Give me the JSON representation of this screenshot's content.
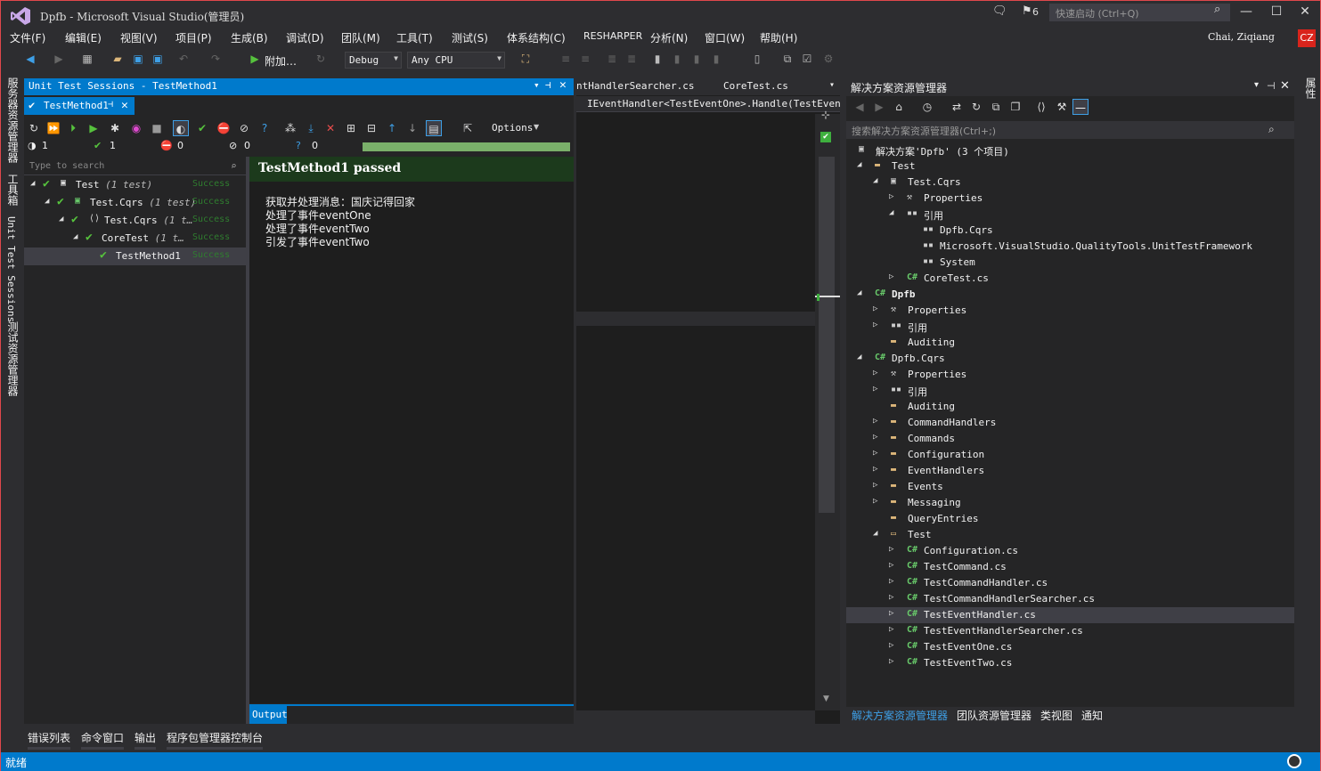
{
  "window": {
    "title": "Dpfb - Microsoft Visual Studio(管理员)",
    "notifications_count": "6",
    "quick_launch_placeholder": "快速启动 (Ctrl+Q)"
  },
  "menu": [
    "文件(F)",
    "编辑(E)",
    "视图(V)",
    "项目(P)",
    "生成(B)",
    "调试(D)",
    "团队(M)",
    "工具(T)",
    "测试(S)",
    "体系结构(C)",
    "RESHARPER",
    "分析(N)",
    "窗口(W)",
    "帮助(H)"
  ],
  "user": {
    "name": "Chai, Ziqiang",
    "initials": "CZ"
  },
  "toolbar": {
    "attach_label": "附加…",
    "config": "Debug",
    "platform": "Any CPU"
  },
  "left_tabs": [
    "服务器资源管理器",
    "工具箱",
    "Unit Test Sessions",
    "测试资源管理器"
  ],
  "right_tabs": [
    "属性"
  ],
  "unit_test": {
    "panel_title": "Unit Test Sessions - TestMethod1",
    "session_tab": "TestMethod1",
    "options_label": "Options",
    "counts": {
      "total": "1",
      "passed": "1",
      "failed": "0",
      "ignored": "0",
      "unknown": "0"
    },
    "progress": 1.0,
    "search_placeholder": "Type to search",
    "tree": [
      {
        "label": "Test",
        "count": "(1 test)",
        "status": "Success"
      },
      {
        "label": "Test.Cqrs",
        "count": "(1 test)",
        "status": "Success"
      },
      {
        "label": "Test.Cqrs",
        "count": "(1 t…",
        "status": "Success"
      },
      {
        "label": "CoreTest",
        "count": "(1 t…",
        "status": "Success"
      },
      {
        "label": "TestMethod1",
        "count": "",
        "status": "Success"
      }
    ],
    "detail_title": "TestMethod1 passed",
    "detail_output": "获取并处理消息：国庆记得回家\n处理了事件eventOne\n处理了事件eventTwo\n引发了事件eventTwo",
    "output_tab": "Output"
  },
  "editor": {
    "tabs": [
      "ntHandlerSearcher.cs",
      "CoreTest.cs"
    ],
    "nav": "IEventHandler<TestEventOne>.Handle(TestEvent("
  },
  "solution_explorer": {
    "title": "解决方案资源管理器",
    "search_placeholder": "搜索解决方案资源管理器(Ctrl+;)",
    "tree": [
      {
        "label": "解决方案'Dpfb' (3 个项目)",
        "icon": "solution-icon"
      },
      {
        "label": "Test",
        "icon": "folder-icon"
      },
      {
        "label": "Test.Cqrs",
        "icon": "project-icon"
      },
      {
        "label": "Properties",
        "icon": "wrench-icon"
      },
      {
        "label": "引用",
        "icon": "references-icon"
      },
      {
        "label": "Dpfb.Cqrs",
        "icon": "reference-icon"
      },
      {
        "label": "Microsoft.VisualStudio.QualityTools.UnitTestFramework",
        "icon": "reference-icon"
      },
      {
        "label": "System",
        "icon": "reference-icon"
      },
      {
        "label": "CoreTest.cs",
        "icon": "csharp-file-icon"
      },
      {
        "label": "Dpfb",
        "icon": "csharp-project-icon"
      },
      {
        "label": "Properties",
        "icon": "wrench-icon"
      },
      {
        "label": "引用",
        "icon": "references-icon"
      },
      {
        "label": "Auditing",
        "icon": "folder-icon"
      },
      {
        "label": "Dpfb.Cqrs",
        "icon": "csharp-project-icon"
      },
      {
        "label": "Properties",
        "icon": "wrench-icon"
      },
      {
        "label": "引用",
        "icon": "references-icon"
      },
      {
        "label": "Auditing",
        "icon": "folder-icon"
      },
      {
        "label": "CommandHandlers",
        "icon": "folder-icon"
      },
      {
        "label": "Commands",
        "icon": "folder-icon"
      },
      {
        "label": "Configuration",
        "icon": "folder-icon"
      },
      {
        "label": "EventHandlers",
        "icon": "folder-icon"
      },
      {
        "label": "Events",
        "icon": "folder-icon"
      },
      {
        "label": "Messaging",
        "icon": "folder-icon"
      },
      {
        "label": "QueryEntries",
        "icon": "folder-icon"
      },
      {
        "label": "Test",
        "icon": "folder-open-icon"
      },
      {
        "label": "Configuration.cs",
        "icon": "csharp-file-icon"
      },
      {
        "label": "TestCommand.cs",
        "icon": "csharp-file-icon"
      },
      {
        "label": "TestCommandHandler.cs",
        "icon": "csharp-file-icon"
      },
      {
        "label": "TestCommandHandlerSearcher.cs",
        "icon": "csharp-file-icon"
      },
      {
        "label": "TestEventHandler.cs",
        "icon": "csharp-file-icon"
      },
      {
        "label": "TestEventHandlerSearcher.cs",
        "icon": "csharp-file-icon"
      },
      {
        "label": "TestEventOne.cs",
        "icon": "csharp-file-icon"
      },
      {
        "label": "TestEventTwo.cs",
        "icon": "csharp-file-icon"
      }
    ],
    "bottom_tabs": [
      "解决方案资源管理器",
      "团队资源管理器",
      "类视图",
      "通知"
    ]
  },
  "bottom_tabs": [
    "错误列表",
    "命令窗口",
    "输出",
    "程序包管理器控制台"
  ],
  "status": "就绪",
  "colors": {
    "accent": "#007acc",
    "success": "#56c23d",
    "badge": "#d9241c"
  }
}
